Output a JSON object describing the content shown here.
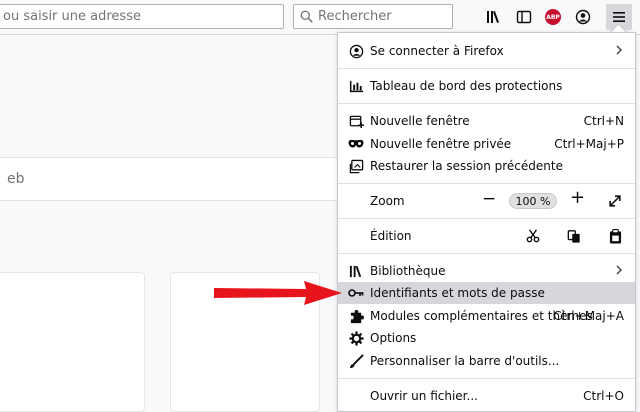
{
  "toolbar": {
    "url_placeholder": "ou saisir une adresse",
    "search_placeholder": "Rechercher",
    "abp_label": "ABP"
  },
  "content": {
    "search_placeholder": "eb"
  },
  "menu": {
    "sign_in": "Se connecter à Firefox",
    "protections": "Tableau de bord des protections",
    "new_window": "Nouvelle fenêtre",
    "new_window_sc": "Ctrl+N",
    "private_window": "Nouvelle fenêtre privée",
    "private_window_sc": "Ctrl+Maj+P",
    "restore_session": "Restaurer la session précédente",
    "zoom_label": "Zoom",
    "zoom_value": "100 %",
    "zoom_minus": "−",
    "zoom_plus": "+",
    "edit_label": "Édition",
    "library": "Bibliothèque",
    "logins": "Identifiants et mots de passe",
    "addons": "Modules complémentaires et thèmes",
    "addons_sc": "Ctrl+Maj+A",
    "options": "Options",
    "customize": "Personnaliser la barre d'outils...",
    "open_file": "Ouvrir un fichier...",
    "open_file_sc": "Ctrl+O"
  },
  "colors": {
    "arrow": "#e8141c",
    "highlight": "#d7d7db",
    "abp": "#c70d2c"
  }
}
